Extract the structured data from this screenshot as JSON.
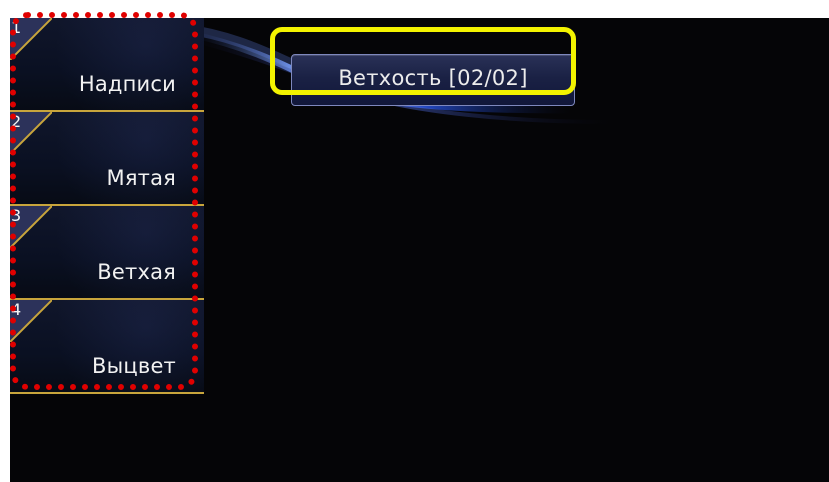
{
  "menu": {
    "items": [
      {
        "number": "1",
        "label": "Надписи"
      },
      {
        "number": "2",
        "label": "Мятая"
      },
      {
        "number": "3",
        "label": "Ветхая"
      },
      {
        "number": "4",
        "label": "Выцвет"
      }
    ]
  },
  "header": {
    "mode_button_label": "Ветхость [02/02]"
  },
  "colors": {
    "screen_background": "#050507",
    "menu_background": "#0a1022",
    "menu_border": "#c8a53c",
    "highlight_red": "#e00000",
    "highlight_yellow": "#f3f300",
    "button_text": "#ececec"
  }
}
